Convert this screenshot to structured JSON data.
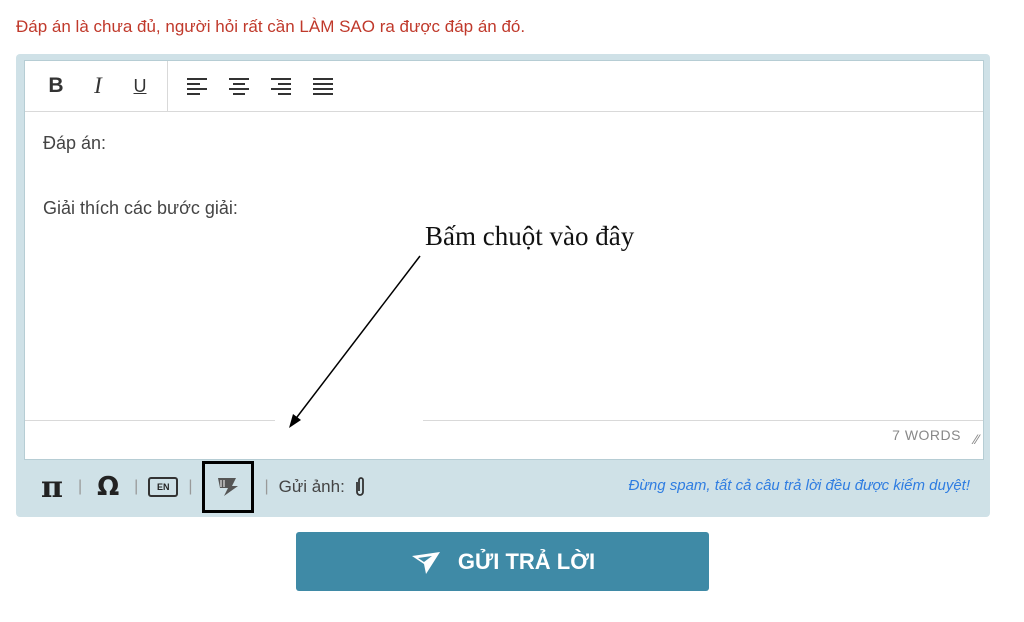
{
  "warning_text": "Đáp án là chưa đủ, người hỏi rất cần LÀM SAO ra được đáp án đó.",
  "toolbar": {
    "bold_label": "B",
    "italic_label": "I",
    "underline_label": "U",
    "align_icons": [
      "align-left-icon",
      "align-center-icon",
      "align-right-icon",
      "align-justify-icon"
    ]
  },
  "editor": {
    "line1": "Đáp án:",
    "line2": "Giải thích các bước giải:",
    "word_count": "7 WORDS"
  },
  "annotation": {
    "text": "Bấm chuột vào đây"
  },
  "bottom_bar": {
    "pi_label": "π",
    "omega_label": "Ω",
    "en_label": "EN",
    "send_image_label": "Gửi ảnh:",
    "spam_note": "Đừng spam, tất cả câu trả lời đều được kiểm duyệt!"
  },
  "submit": {
    "label": "GỬI TRẢ LỜI"
  },
  "colors": {
    "warning": "#c0392b",
    "frame": "#cfe1e7",
    "submit": "#3f8aa6",
    "spam_note": "#2f7de1"
  }
}
